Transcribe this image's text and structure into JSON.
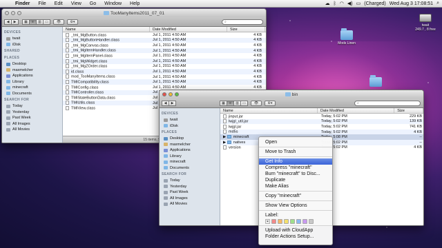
{
  "menubar": {
    "app": "Finder",
    "menus": [
      "File",
      "Edit",
      "View",
      "Go",
      "Window",
      "Help"
    ],
    "battery": "(Charged)",
    "clock": "Wed Aug 3  17:08:51"
  },
  "desktop": {
    "disk_label": "twait",
    "disk_sub": "249.7 , 8 free",
    "folder_label": "Mods Linen",
    "folder2_label": ""
  },
  "back_window": {
    "title": "TooManyItems2011_07_01",
    "search_placeholder": "",
    "sidebar": [
      {
        "head": "DEVICES",
        "items": [
          "twait",
          "iDisk"
        ]
      },
      {
        "head": "SHARED",
        "items": []
      },
      {
        "head": "PLACES",
        "items": [
          "Desktop",
          "maxmelcher",
          "Applications",
          "Library",
          "minecraft",
          "Documents"
        ]
      },
      {
        "head": "SEARCH FOR",
        "items": [
          "Today",
          "Yesterday",
          "Past Week",
          "All Images",
          "All Movies"
        ]
      }
    ],
    "columns": [
      "Name",
      "Date Modified",
      "Size"
    ],
    "rows": [
      {
        "name": "_tmi_MgButton.class",
        "date": "Jul 1, 2011 4:50 AM",
        "size": "4 KB"
      },
      {
        "name": "_tmi_MgButtonHandler.class",
        "date": "Jul 1, 2011 4:50 AM",
        "size": "4 KB"
      },
      {
        "name": "_tmi_MgCanvas.class",
        "date": "Jul 1, 2011 4:50 AM",
        "size": "4 KB"
      },
      {
        "name": "_tmi_MgItemHandler.class",
        "date": "Jul 1, 2011 4:50 AM",
        "size": "4 KB"
      },
      {
        "name": "_tmi_MgItemPanel.class",
        "date": "Jul 1, 2011 4:50 AM",
        "size": "4 KB"
      },
      {
        "name": "_tmi_MgWidget.class",
        "date": "Jul 1, 2011 4:50 AM",
        "size": "4 KB"
      },
      {
        "name": "_tmi_MgZOrder.class",
        "date": "Jul 1, 2011 4:50 AM",
        "size": "4 KB"
      },
      {
        "name": "id.class",
        "date": "Jul 1, 2011 4:50 AM",
        "size": "4 KB"
      },
      {
        "name": "mod_TooManyItems.class",
        "date": "Jul 1, 2011 4:50 AM",
        "size": "4 KB"
      },
      {
        "name": "TMICompatibility.class",
        "date": "Jul 1, 2011 4:50 AM",
        "size": "4 KB"
      },
      {
        "name": "TMIConfig.class",
        "date": "Jul 1, 2011 4:50 AM",
        "size": "4 KB"
      },
      {
        "name": "TMIController.class",
        "date": "Jul 1, 2011 4:50 AM",
        "size": "4 KB"
      },
      {
        "name": "TMIStateButtonData.class",
        "date": "Jul 1, 2011 4:50 AM",
        "size": "4 KB"
      },
      {
        "name": "TMIUtils.class",
        "date": "Jul 1, 2011 4:50 AM",
        "size": "4 KB"
      },
      {
        "name": "TMIView.class",
        "date": "Jul 1, 2011 4:50 AM",
        "size": "4 KB"
      }
    ],
    "status": "15 items, 96.9 GB available"
  },
  "front_window": {
    "title": "bin",
    "sidebar": [
      {
        "head": "DEVICES",
        "items": [
          "twait",
          "iDisk"
        ]
      },
      {
        "head": "PLACES",
        "items": [
          "Desktop",
          "maxmelcher",
          "Applications",
          "Library",
          "minecraft",
          "Documents"
        ]
      },
      {
        "head": "SEARCH FOR",
        "items": [
          "Today",
          "Yesterday",
          "Past Week",
          "All Images",
          "All Movies"
        ]
      }
    ],
    "columns": [
      "Name",
      "Date Modified",
      "Size"
    ],
    "rows": [
      {
        "name": "jinput.jar",
        "date": "Today, 5:02 PM",
        "size": "229 KB",
        "folder": false
      },
      {
        "name": "lwjgl_util.jar",
        "date": "Today, 5:02 PM",
        "size": "139 KB",
        "folder": false
      },
      {
        "name": "lwjgl.jar",
        "date": "Today, 5:02 PM",
        "size": "741 KB",
        "folder": false
      },
      {
        "name": "md5s",
        "date": "Today, 5:02 PM",
        "size": "4 KB",
        "folder": false
      },
      {
        "name": "minecraft",
        "date": "Today, 5:08 PM",
        "size": "--",
        "folder": true
      },
      {
        "name": "natives",
        "date": "Today, 5:02 PM",
        "size": "--",
        "folder": true
      },
      {
        "name": "version",
        "date": "Today, 5:02 PM",
        "size": "4 KB",
        "folder": false
      }
    ]
  },
  "context_menu": {
    "items": [
      {
        "label": "Open",
        "sep_after": true
      },
      {
        "label": "Move to Trash",
        "sep_after": true
      },
      {
        "label": "Get Info",
        "highlight": true
      },
      {
        "label": "Compress \"minecraft\""
      },
      {
        "label": "Burn \"minecraft\" to Disc..."
      },
      {
        "label": "Duplicate"
      },
      {
        "label": "Make Alias",
        "sep_after": true
      },
      {
        "label": "Copy \"minecraft\"",
        "sep_after": true
      },
      {
        "label": "Show View Options",
        "sep_after": true
      },
      {
        "label": "Label:"
      }
    ],
    "label_colors": [
      "#ffffff",
      "#f28a8a",
      "#f5b86a",
      "#f3e06d",
      "#9fe08a",
      "#8ab8f2",
      "#c89af0",
      "#c8c8c8"
    ],
    "label_none_glyph": "✕",
    "bottom_items": [
      "Upload with CloudApp",
      "Folder Actions Setup..."
    ]
  }
}
